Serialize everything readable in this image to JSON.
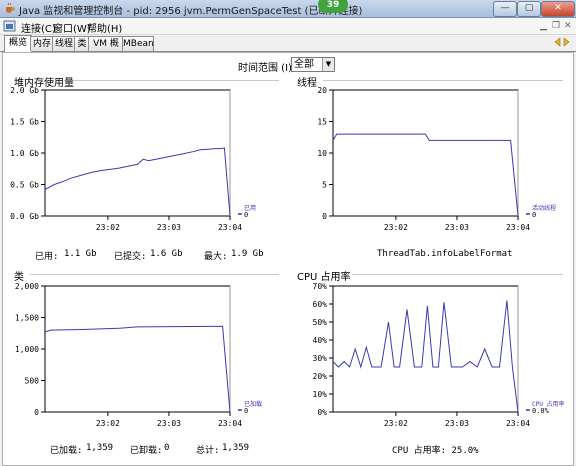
{
  "window": {
    "title": "Java 监视和管理控制台 - pid: 2956 jvm.PermGenSpaceTest (已断开连接)",
    "badge": "39",
    "buttons": {
      "minimize": "—",
      "maximize": "▢",
      "close": "✕"
    }
  },
  "menu": {
    "items": [
      "连接(C)",
      "窗口(W)",
      "帮助(H)"
    ]
  },
  "tabs": [
    "概览",
    "内存",
    "线程",
    "类",
    "VM 概要",
    "MBean"
  ],
  "time_range": {
    "label": "时间范围 (I):",
    "value": "全部"
  },
  "colors": {
    "line": "#3a3ab0",
    "axis": "#000000"
  },
  "panels": {
    "heap": {
      "title": "堆内存使用量",
      "legend": {
        "name": "已用",
        "value": "0"
      },
      "stats": [
        {
          "label": "已用:",
          "value": "1.1 Gb"
        },
        {
          "label": "已提交:",
          "value": "1.6 Gb"
        },
        {
          "label": "最大:",
          "value": "1.9 Gb"
        }
      ]
    },
    "threads": {
      "title": "线程",
      "legend": {
        "name": "活动线程",
        "value": "0"
      },
      "footer": "ThreadTab.infoLabelFormat"
    },
    "classes": {
      "title": "类",
      "legend": {
        "name": "已加载",
        "value": "0"
      },
      "stats": [
        {
          "label": "已加载:",
          "value": "1,359"
        },
        {
          "label": "已卸载:",
          "value": "0"
        },
        {
          "label": "总计:",
          "value": "1,359"
        }
      ]
    },
    "cpu": {
      "title": "CPU 占用率",
      "legend": {
        "name": "CPU 占用率",
        "value": "0.0%"
      },
      "footer": "CPU 占用率: 25.0%"
    }
  },
  "chart_data": [
    {
      "type": "line",
      "title": "堆内存使用量",
      "ytick_labels": [
        "2.0 Gb",
        "1.5 Gb",
        "1.0 Gb",
        "0.5 Gb",
        "0.0 Gb"
      ],
      "xtick_labels": [
        "23:02",
        "23:03",
        "23:04"
      ],
      "ylim": [
        0,
        2.0
      ],
      "x": [
        0,
        0.05,
        0.1,
        0.14,
        0.2,
        0.25,
        0.3,
        0.35,
        0.4,
        0.45,
        0.5,
        0.53,
        0.56,
        0.6,
        0.65,
        0.7,
        0.75,
        0.8,
        0.84,
        0.88,
        0.92,
        0.95,
        0.97,
        1.0
      ],
      "series": [
        {
          "values": [
            0.42,
            0.5,
            0.55,
            0.6,
            0.65,
            0.69,
            0.72,
            0.74,
            0.76,
            0.79,
            0.82,
            0.9,
            0.88,
            0.9,
            0.93,
            0.96,
            0.99,
            1.02,
            1.05,
            1.06,
            1.07,
            1.07,
            1.08,
            0.0
          ]
        }
      ]
    },
    {
      "type": "line",
      "title": "线程",
      "ytick_labels": [
        "20",
        "15",
        "10",
        "5",
        "0"
      ],
      "xtick_labels": [
        "23:02",
        "23:03",
        "23:04"
      ],
      "ylim": [
        0,
        20
      ],
      "x": [
        0,
        0.02,
        0.5,
        0.52,
        0.96,
        1.0
      ],
      "series": [
        {
          "values": [
            12,
            13,
            13,
            12,
            12,
            0
          ]
        }
      ]
    },
    {
      "type": "line",
      "title": "类",
      "ytick_labels": [
        "2,000",
        "1,500",
        "1,000",
        "500",
        "0"
      ],
      "xtick_labels": [
        "23:02",
        "23:03",
        "23:04"
      ],
      "ylim": [
        0,
        2000
      ],
      "x": [
        0,
        0.03,
        0.2,
        0.4,
        0.5,
        0.7,
        0.9,
        0.96,
        1.0
      ],
      "series": [
        {
          "values": [
            1270,
            1300,
            1310,
            1330,
            1350,
            1355,
            1359,
            1359,
            0
          ]
        }
      ]
    },
    {
      "type": "line",
      "title": "CPU 占用率",
      "ytick_labels": [
        "70%",
        "60%",
        "50%",
        "40%",
        "30%",
        "20%",
        "10%",
        "0%"
      ],
      "xtick_labels": [
        "23:02",
        "23:03",
        "23:04"
      ],
      "ylim": [
        0,
        70
      ],
      "x": [
        0,
        0.03,
        0.06,
        0.09,
        0.12,
        0.15,
        0.18,
        0.21,
        0.26,
        0.3,
        0.33,
        0.36,
        0.4,
        0.44,
        0.48,
        0.51,
        0.54,
        0.57,
        0.6,
        0.64,
        0.67,
        0.7,
        0.74,
        0.78,
        0.82,
        0.86,
        0.9,
        0.94,
        0.97,
        1.0
      ],
      "series": [
        {
          "values": [
            28,
            25,
            28,
            25,
            35,
            25,
            36,
            25,
            25,
            50,
            25,
            25,
            57,
            25,
            25,
            59,
            25,
            25,
            61,
            25,
            25,
            25,
            28,
            25,
            35,
            25,
            25,
            62,
            25,
            0
          ]
        }
      ]
    }
  ]
}
